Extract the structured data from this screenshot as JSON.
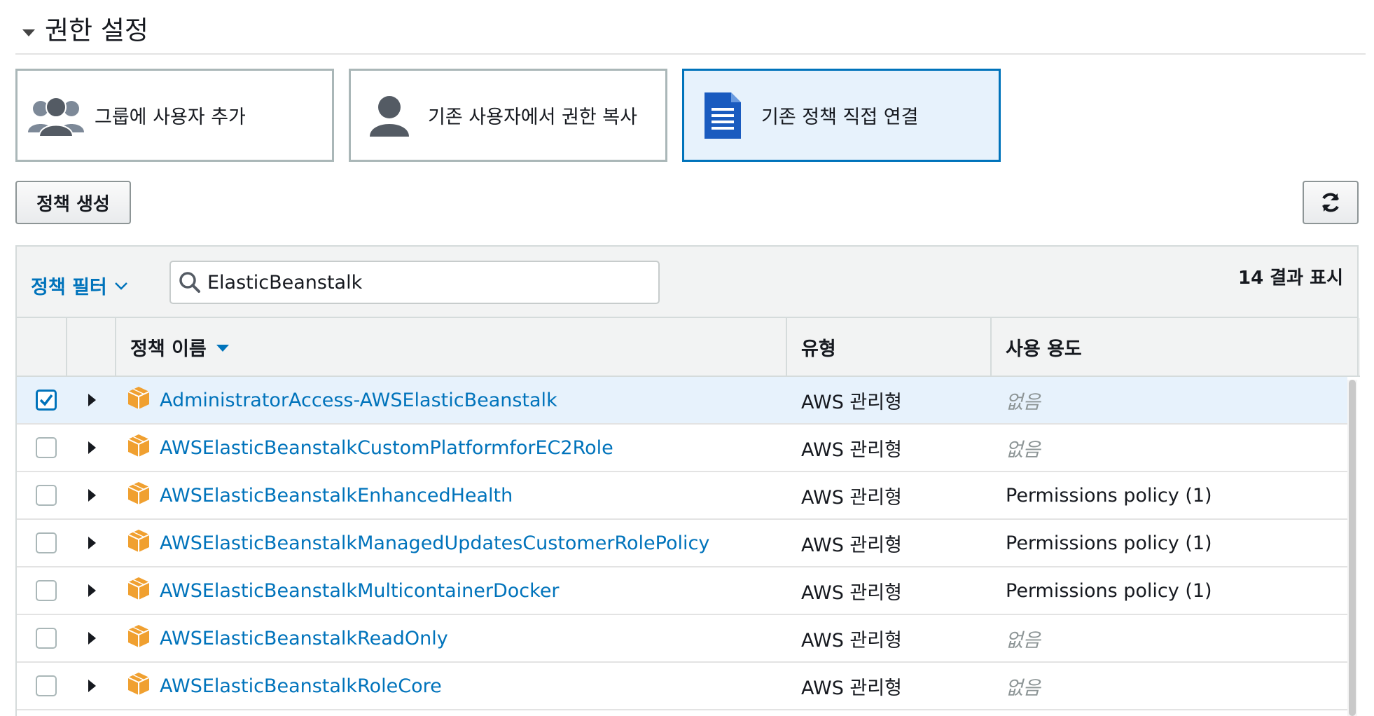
{
  "section": {
    "title": "권한 설정"
  },
  "tiles": [
    {
      "label": "그룹에 사용자 추가",
      "icon": "group-icon",
      "selected": false
    },
    {
      "label": "기존 사용자에서 권한 복사",
      "icon": "user-icon",
      "selected": false
    },
    {
      "label": "기존 정책 직접 연결",
      "icon": "document-icon",
      "selected": true
    }
  ],
  "toolbar": {
    "create_policy_label": "정책 생성",
    "refresh_icon": "refresh-icon"
  },
  "filter": {
    "dropdown_label": "정책 필터",
    "search_value": "ElasticBeanstalk",
    "result_count": "14 결과 표시"
  },
  "table": {
    "columns": {
      "name": "정책 이름",
      "type": "유형",
      "usage": "사용 용도"
    },
    "rows": [
      {
        "name": "AdministratorAccess-AWSElasticBeanstalk",
        "type": "AWS 관리형",
        "usage": "없음",
        "usage_none": true,
        "checked": true
      },
      {
        "name": "AWSElasticBeanstalkCustomPlatformforEC2Role",
        "type": "AWS 관리형",
        "usage": "없음",
        "usage_none": true,
        "checked": false
      },
      {
        "name": "AWSElasticBeanstalkEnhancedHealth",
        "type": "AWS 관리형",
        "usage": "Permissions policy (1)",
        "usage_none": false,
        "checked": false
      },
      {
        "name": "AWSElasticBeanstalkManagedUpdatesCustomerRolePolicy",
        "type": "AWS 관리형",
        "usage": "Permissions policy (1)",
        "usage_none": false,
        "checked": false
      },
      {
        "name": "AWSElasticBeanstalkMulticontainerDocker",
        "type": "AWS 관리형",
        "usage": "Permissions policy (1)",
        "usage_none": false,
        "checked": false
      },
      {
        "name": "AWSElasticBeanstalkReadOnly",
        "type": "AWS 관리형",
        "usage": "없음",
        "usage_none": true,
        "checked": false
      },
      {
        "name": "AWSElasticBeanstalkRoleCore",
        "type": "AWS 관리형",
        "usage": "없음",
        "usage_none": true,
        "checked": false
      }
    ]
  },
  "colors": {
    "link": "#0073bb",
    "selected_bg": "#e7f2fc",
    "policy_icon": "#f0a030"
  }
}
